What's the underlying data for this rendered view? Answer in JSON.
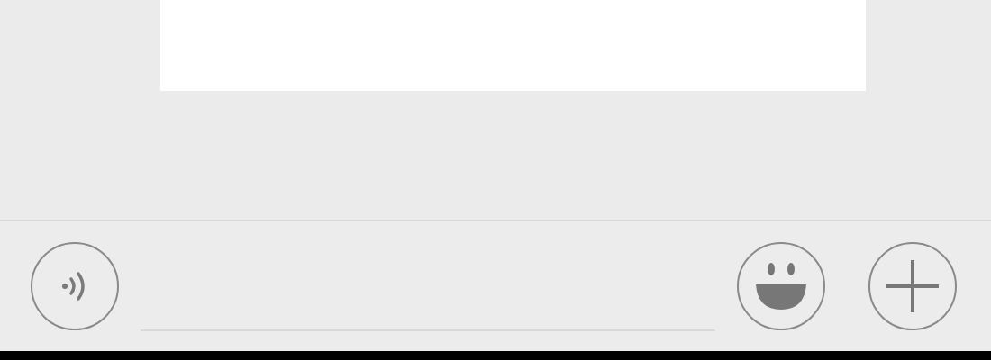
{
  "input_bar": {
    "buttons": [
      {
        "kind": "voice"
      },
      {
        "kind": "input"
      },
      {
        "kind": "emoji"
      },
      {
        "kind": "more"
      }
    ]
  }
}
